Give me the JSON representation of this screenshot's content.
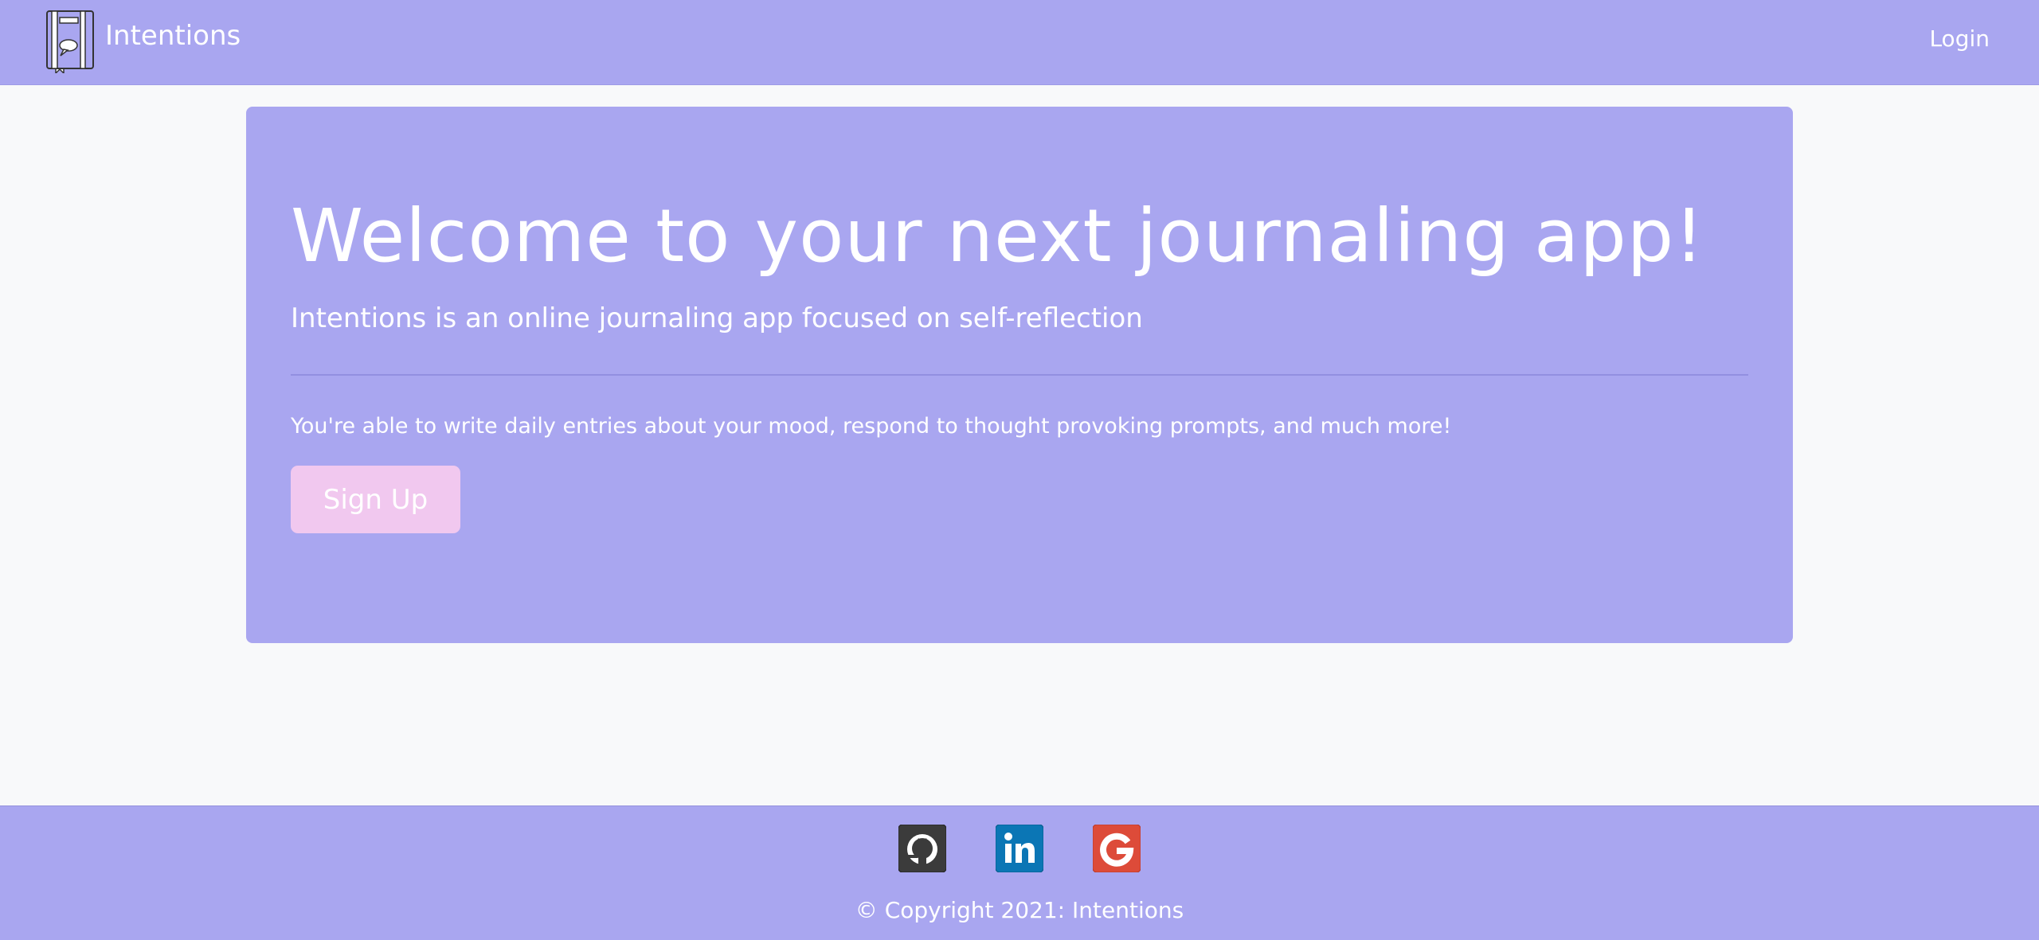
{
  "navbar": {
    "brand_text": "Intentions",
    "login_label": "Login",
    "logo_icon": "journal-book-icon"
  },
  "hero": {
    "title": "Welcome to your next journaling app!",
    "lead": "Intentions is an online journaling app focused on self-reflection",
    "description": "You're able to write daily entries about your mood, respond to thought provoking prompts, and much more!",
    "signup_label": "Sign Up"
  },
  "footer": {
    "social_links": [
      {
        "icon": "github-icon",
        "color": "#3b3b3b"
      },
      {
        "icon": "linkedin-icon",
        "color": "#0b76b5"
      },
      {
        "icon": "google-icon",
        "color": "#dd4b39"
      }
    ],
    "copyright": "© Copyright 2021: Intentions"
  },
  "colors": {
    "primary": "#a9a6f0",
    "accent": "#f1c8ef",
    "background": "#f8f9fa",
    "text": "#ffffff"
  }
}
